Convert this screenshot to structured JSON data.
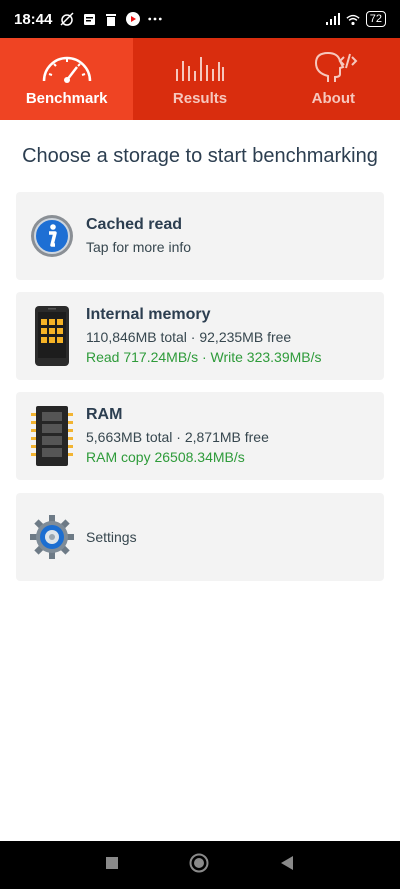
{
  "status_bar": {
    "time": "18:44",
    "battery": "72"
  },
  "tabs": [
    {
      "label": "Benchmark",
      "icon": "speedometer-icon",
      "active": true
    },
    {
      "label": "Results",
      "icon": "bars-icon",
      "active": false
    },
    {
      "label": "About",
      "icon": "head-code-icon",
      "active": false
    }
  ],
  "heading": "Choose a storage to start benchmarking",
  "cards": {
    "cached": {
      "title": "Cached read",
      "line1": "Tap for more info"
    },
    "internal": {
      "title": "Internal memory",
      "line1": "110,846MB total · 92,235MB free",
      "line2": "Read 717.24MB/s · Write 323.39MB/s"
    },
    "ram": {
      "title": "RAM",
      "line1": "5,663MB total · 2,871MB free",
      "line2": "RAM copy 26508.34MB/s"
    },
    "settings": {
      "label": "Settings"
    }
  },
  "colors": {
    "tab_bg": "#d92d0e",
    "tab_active": "#ef4423",
    "card_bg": "#f3f3f3",
    "green": "#2e9b3a"
  }
}
